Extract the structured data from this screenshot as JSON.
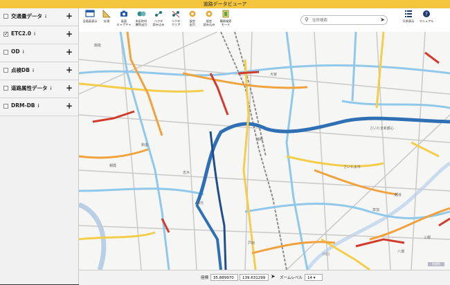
{
  "app": {
    "title": "道路データビューア"
  },
  "sidebar": {
    "layers": [
      {
        "label": "交通量データ",
        "checked": false
      },
      {
        "label": "ETC2.0",
        "checked": true
      },
      {
        "label": "OD",
        "checked": false
      },
      {
        "label": "点検DB",
        "checked": false
      },
      {
        "label": "道路属性データ",
        "checked": false
      },
      {
        "label": "DRM-DB",
        "checked": false
      }
    ],
    "info_glyph": "i",
    "add_glyph": "+"
  },
  "toolbar": {
    "tools": [
      {
        "label": "全画面表示",
        "icon": "fullscreen-icon"
      },
      {
        "label": "計測",
        "icon": "ruler-icon"
      },
      {
        "label": "画面\nキャプチャ",
        "icon": "camera-icon"
      },
      {
        "label": "市区町村\n属性出力",
        "icon": "municipality-export-icon"
      },
      {
        "label": "ベクタ\n読み込み",
        "icon": "vector-load-icon"
      },
      {
        "label": "ベクタ\nクリア",
        "icon": "vector-clear-icon"
      },
      {
        "label": "設定\n出力",
        "icon": "settings-export-icon"
      },
      {
        "label": "設定\n読み込み",
        "icon": "settings-import-icon"
      },
      {
        "label": "簡易検索\nモード",
        "icon": "simple-search-icon"
      }
    ],
    "legend_label": "凡例表示",
    "manual_label": "マニュアル",
    "search_placeholder": "住所検索"
  },
  "map": {
    "labels": [
      "飯能",
      "大宮",
      "さいたま新都心",
      "浦和",
      "さいたま市",
      "朝霞",
      "和光",
      "新座",
      "志木",
      "戸田",
      "川口",
      "草加",
      "越谷",
      "三郷",
      "八潮"
    ],
    "colors": {
      "light_blue": "#8fc8ea",
      "blue": "#2f6fb4",
      "dark_blue": "#1e4f8c",
      "orange": "#f1a23c",
      "yellow": "#f4cd4a",
      "red": "#d23b2b"
    },
    "attribution": "地理院"
  },
  "statusbar": {
    "coord_label": "座標",
    "lat": "35.889970",
    "lng": "139.631299",
    "zoom_label": "ズームレベル",
    "zoom": "14"
  }
}
